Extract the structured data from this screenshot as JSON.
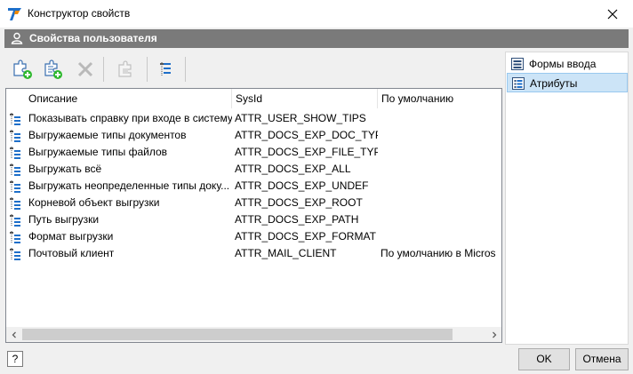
{
  "window": {
    "title": "Конструктор свойств",
    "close_icon": "close-icon",
    "app_icon": "app-logo-icon"
  },
  "header": {
    "icon": "user-icon",
    "title": "Свойства пользователя"
  },
  "toolbar": {
    "buttons": [
      {
        "name": "add-attribute",
        "icon": "puzzle-add-icon",
        "enabled": true
      },
      {
        "name": "add-attribute-list",
        "icon": "puzzle-list-add-icon",
        "enabled": true
      },
      {
        "name": "delete",
        "icon": "delete-icon",
        "enabled": false
      },
      {
        "name": "edit",
        "icon": "puzzle-edit-icon",
        "enabled": false
      },
      {
        "name": "tree-view",
        "icon": "tree-list-icon",
        "enabled": true
      }
    ]
  },
  "list": {
    "columns": [
      "Описание",
      "SysId",
      "По умолчанию"
    ],
    "rows": [
      {
        "desc": "Показывать справку при входе в систему",
        "sysid": "ATTR_USER_SHOW_TIPS",
        "default": ""
      },
      {
        "desc": "Выгружаемые типы документов",
        "sysid": "ATTR_DOCS_EXP_DOC_TYPE",
        "default": ""
      },
      {
        "desc": "Выгружаемые типы файлов",
        "sysid": "ATTR_DOCS_EXP_FILE_TYPE",
        "default": ""
      },
      {
        "desc": "Выгружать всё",
        "sysid": "ATTR_DOCS_EXP_ALL",
        "default": ""
      },
      {
        "desc": "Выгружать неопределенные типы доку...",
        "sysid": "ATTR_DOCS_EXP_UNDEF",
        "default": ""
      },
      {
        "desc": "Корневой объект выгрузки",
        "sysid": "ATTR_DOCS_EXP_ROOT",
        "default": ""
      },
      {
        "desc": "Путь выгрузки",
        "sysid": "ATTR_DOCS_EXP_PATH",
        "default": ""
      },
      {
        "desc": "Формат выгрузки",
        "sysid": "ATTR_DOCS_EXP_FORMAT",
        "default": ""
      },
      {
        "desc": "Почтовый клиент",
        "sysid": "ATTR_MAIL_CLIENT",
        "default": "По умолчанию в Micros"
      }
    ]
  },
  "sidebar": {
    "items": [
      {
        "label": "Формы ввода",
        "icon": "form-icon",
        "selected": false
      },
      {
        "label": "Атрибуты",
        "icon": "attributes-icon",
        "selected": true
      }
    ]
  },
  "footer": {
    "help_label": "?",
    "ok_label": "OK",
    "cancel_label": "Отмена"
  },
  "colors": {
    "header_band": "#7a7a7a",
    "selection": "#cce4f7",
    "accent_green": "#2eb82e",
    "accent_blue": "#1e6fc9"
  }
}
